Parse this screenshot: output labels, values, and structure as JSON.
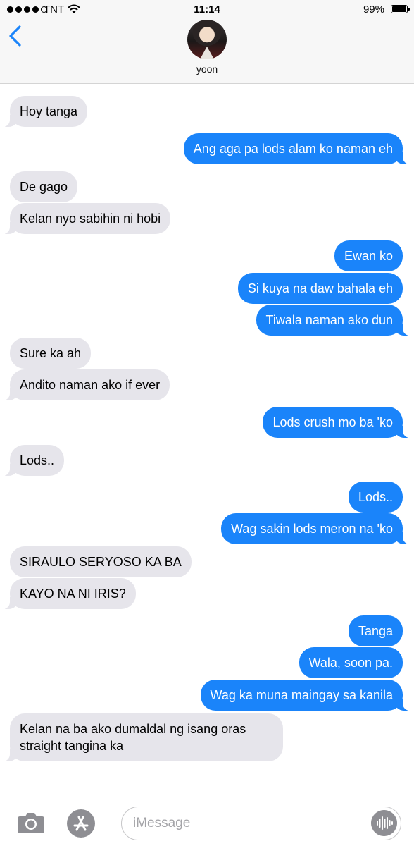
{
  "status_bar": {
    "carrier": "TNT",
    "time": "11:14",
    "battery": "99%"
  },
  "header": {
    "contact_name": "yoon"
  },
  "messages": [
    {
      "side": "in",
      "text": "Hoy tanga"
    },
    {
      "side": "out",
      "text": "Ang aga pa lods alam ko naman eh"
    },
    {
      "side": "in",
      "text": "De gago"
    },
    {
      "side": "in",
      "text": "Kelan nyo sabihin ni hobi"
    },
    {
      "side": "out",
      "text": "Ewan ko"
    },
    {
      "side": "out",
      "text": "Si kuya na daw bahala eh"
    },
    {
      "side": "out",
      "text": "Tiwala naman ako dun"
    },
    {
      "side": "in",
      "text": "Sure ka ah"
    },
    {
      "side": "in",
      "text": "Andito naman ako if ever"
    },
    {
      "side": "out",
      "text": "Lods crush mo ba 'ko"
    },
    {
      "side": "in",
      "text": "Lods.."
    },
    {
      "side": "out",
      "text": "Lods.."
    },
    {
      "side": "out",
      "text": "Wag sakin lods meron na 'ko"
    },
    {
      "side": "in",
      "text": "SIRAULO SERYOSO KA BA"
    },
    {
      "side": "in",
      "text": "KAYO NA NI IRIS?"
    },
    {
      "side": "out",
      "text": "Tanga"
    },
    {
      "side": "out",
      "text": "Wala, soon pa."
    },
    {
      "side": "out",
      "text": "Wag ka muna maingay sa kanila"
    },
    {
      "side": "in",
      "text": "Kelan na ba ako dumaldal ng isang oras\nstraight tangina ka"
    }
  ],
  "composer": {
    "placeholder": "iMessage"
  },
  "icons": {
    "back": "chevron-left-icon",
    "camera": "camera-icon",
    "appstore": "app-store-icon",
    "audio": "waveform-icon",
    "wifi": "wifi-icon"
  },
  "colors": {
    "outgoing": "#1a84fa",
    "incoming": "#e6e5eb",
    "accent": "#1a84fa"
  }
}
